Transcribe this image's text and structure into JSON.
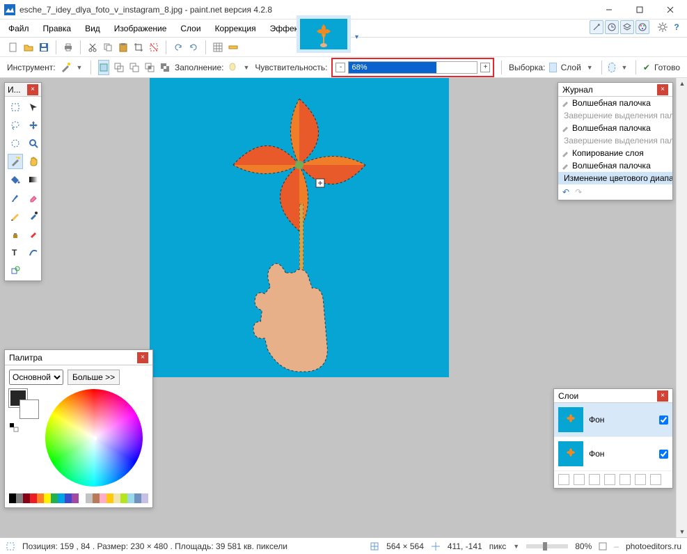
{
  "titlebar": {
    "filename": "esche_7_idey_dlya_foto_v_instagram_8.jpg - paint.net версия 4.2.8"
  },
  "menus": [
    "Файл",
    "Правка",
    "Вид",
    "Изображение",
    "Слои",
    "Коррекция",
    "Эффекты"
  ],
  "toolbar2": {
    "instrument_label": "Инструмент:",
    "fill_label": "Заполнение:",
    "tolerance_label": "Чувствительность:",
    "tolerance_value": "68%",
    "tolerance_percent": 68,
    "sampling_label": "Выборка:",
    "sampling_value": "Слой",
    "commit_label": "Готово"
  },
  "tools_window": {
    "title": "И..."
  },
  "palette": {
    "title": "Палитра",
    "mode": "Основной",
    "more": "Больше >>",
    "swatch_colors": [
      "#000",
      "#7f7f7f",
      "#880015",
      "#ed1c24",
      "#ff7f27",
      "#fff200",
      "#22b14c",
      "#00a2e8",
      "#3f48cc",
      "#a349a4",
      "#ffffff",
      "#c3c3c3",
      "#b97a57",
      "#ffaec9",
      "#ffc90e",
      "#efe4b0",
      "#b5e61d",
      "#99d9ea",
      "#7092be",
      "#c8bfe7"
    ]
  },
  "history": {
    "title": "Журнал",
    "items": [
      {
        "label": "Волшебная палочка",
        "dim": false
      },
      {
        "label": "Завершение выделения палочкой",
        "dim": true
      },
      {
        "label": "Волшебная палочка",
        "dim": false
      },
      {
        "label": "Завершение выделения палочкой",
        "dim": true
      },
      {
        "label": "Копирование слоя",
        "dim": false
      },
      {
        "label": "Волшебная палочка",
        "dim": false
      },
      {
        "label": "Изменение цветового диапазона",
        "dim": false,
        "sel": true
      }
    ]
  },
  "layers": {
    "title": "Слои",
    "items": [
      {
        "name": "Фон",
        "selected": true,
        "visible": true
      },
      {
        "name": "Фон",
        "selected": false,
        "visible": true
      }
    ]
  },
  "status": {
    "pos_label": "Позиция: 159 , 84 . Размер: 230   × 480 . Площадь: 39 581 кв. пиксели",
    "dims": "564  ×  564",
    "cursor": "411, -141",
    "units": "пикс",
    "zoom": "80%",
    "credit": "photoeditors.ru"
  }
}
